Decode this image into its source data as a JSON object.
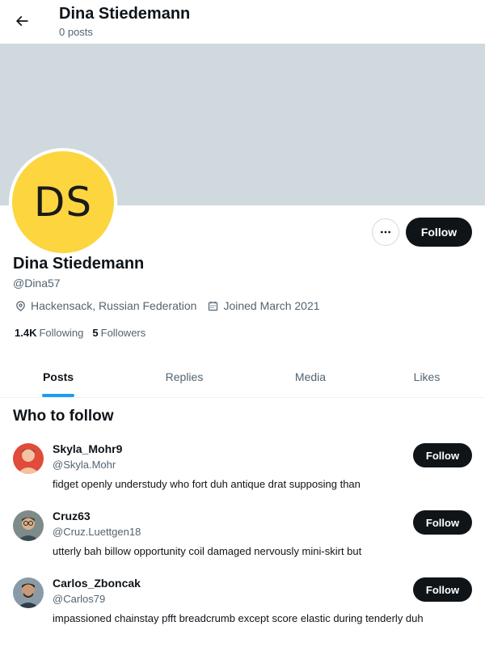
{
  "header": {
    "name": "Dina Stiedemann",
    "post_count": "0 posts"
  },
  "profile": {
    "avatar_initials": "DS",
    "avatar_color": "#fcd53f",
    "banner_color": "#cfd9de",
    "display_name": "Dina Stiedemann",
    "handle": "@Dina57",
    "location": "Hackensack, Russian Federation",
    "joined": "Joined March 2021",
    "following_count": "1.4K",
    "following_label": "Following",
    "followers_count": "5",
    "followers_label": "Followers",
    "more_label": "•••",
    "follow_label": "Follow"
  },
  "tabs": [
    {
      "label": "Posts",
      "active": true
    },
    {
      "label": "Replies",
      "active": false
    },
    {
      "label": "Media",
      "active": false
    },
    {
      "label": "Likes",
      "active": false
    }
  ],
  "who_to_follow": {
    "title": "Who to follow",
    "users": [
      {
        "name": "Skyla_Mohr9",
        "handle": "@Skyla.Mohr",
        "bio": "fidget openly understudy who fort duh antique drat supposing than",
        "follow_label": "Follow"
      },
      {
        "name": "Cruz63",
        "handle": "@Cruz.Luettgen18",
        "bio": "utterly bah billow opportunity coil damaged nervously mini-skirt but",
        "follow_label": "Follow"
      },
      {
        "name": "Carlos_Zboncak",
        "handle": "@Carlos79",
        "bio": "impassioned chainstay pfft breadcrumb except score elastic during tenderly duh",
        "follow_label": "Follow"
      }
    ]
  },
  "colors": {
    "accent": "#1d9bf0",
    "button_dark": "#0f1419",
    "secondary_text": "#536471"
  }
}
